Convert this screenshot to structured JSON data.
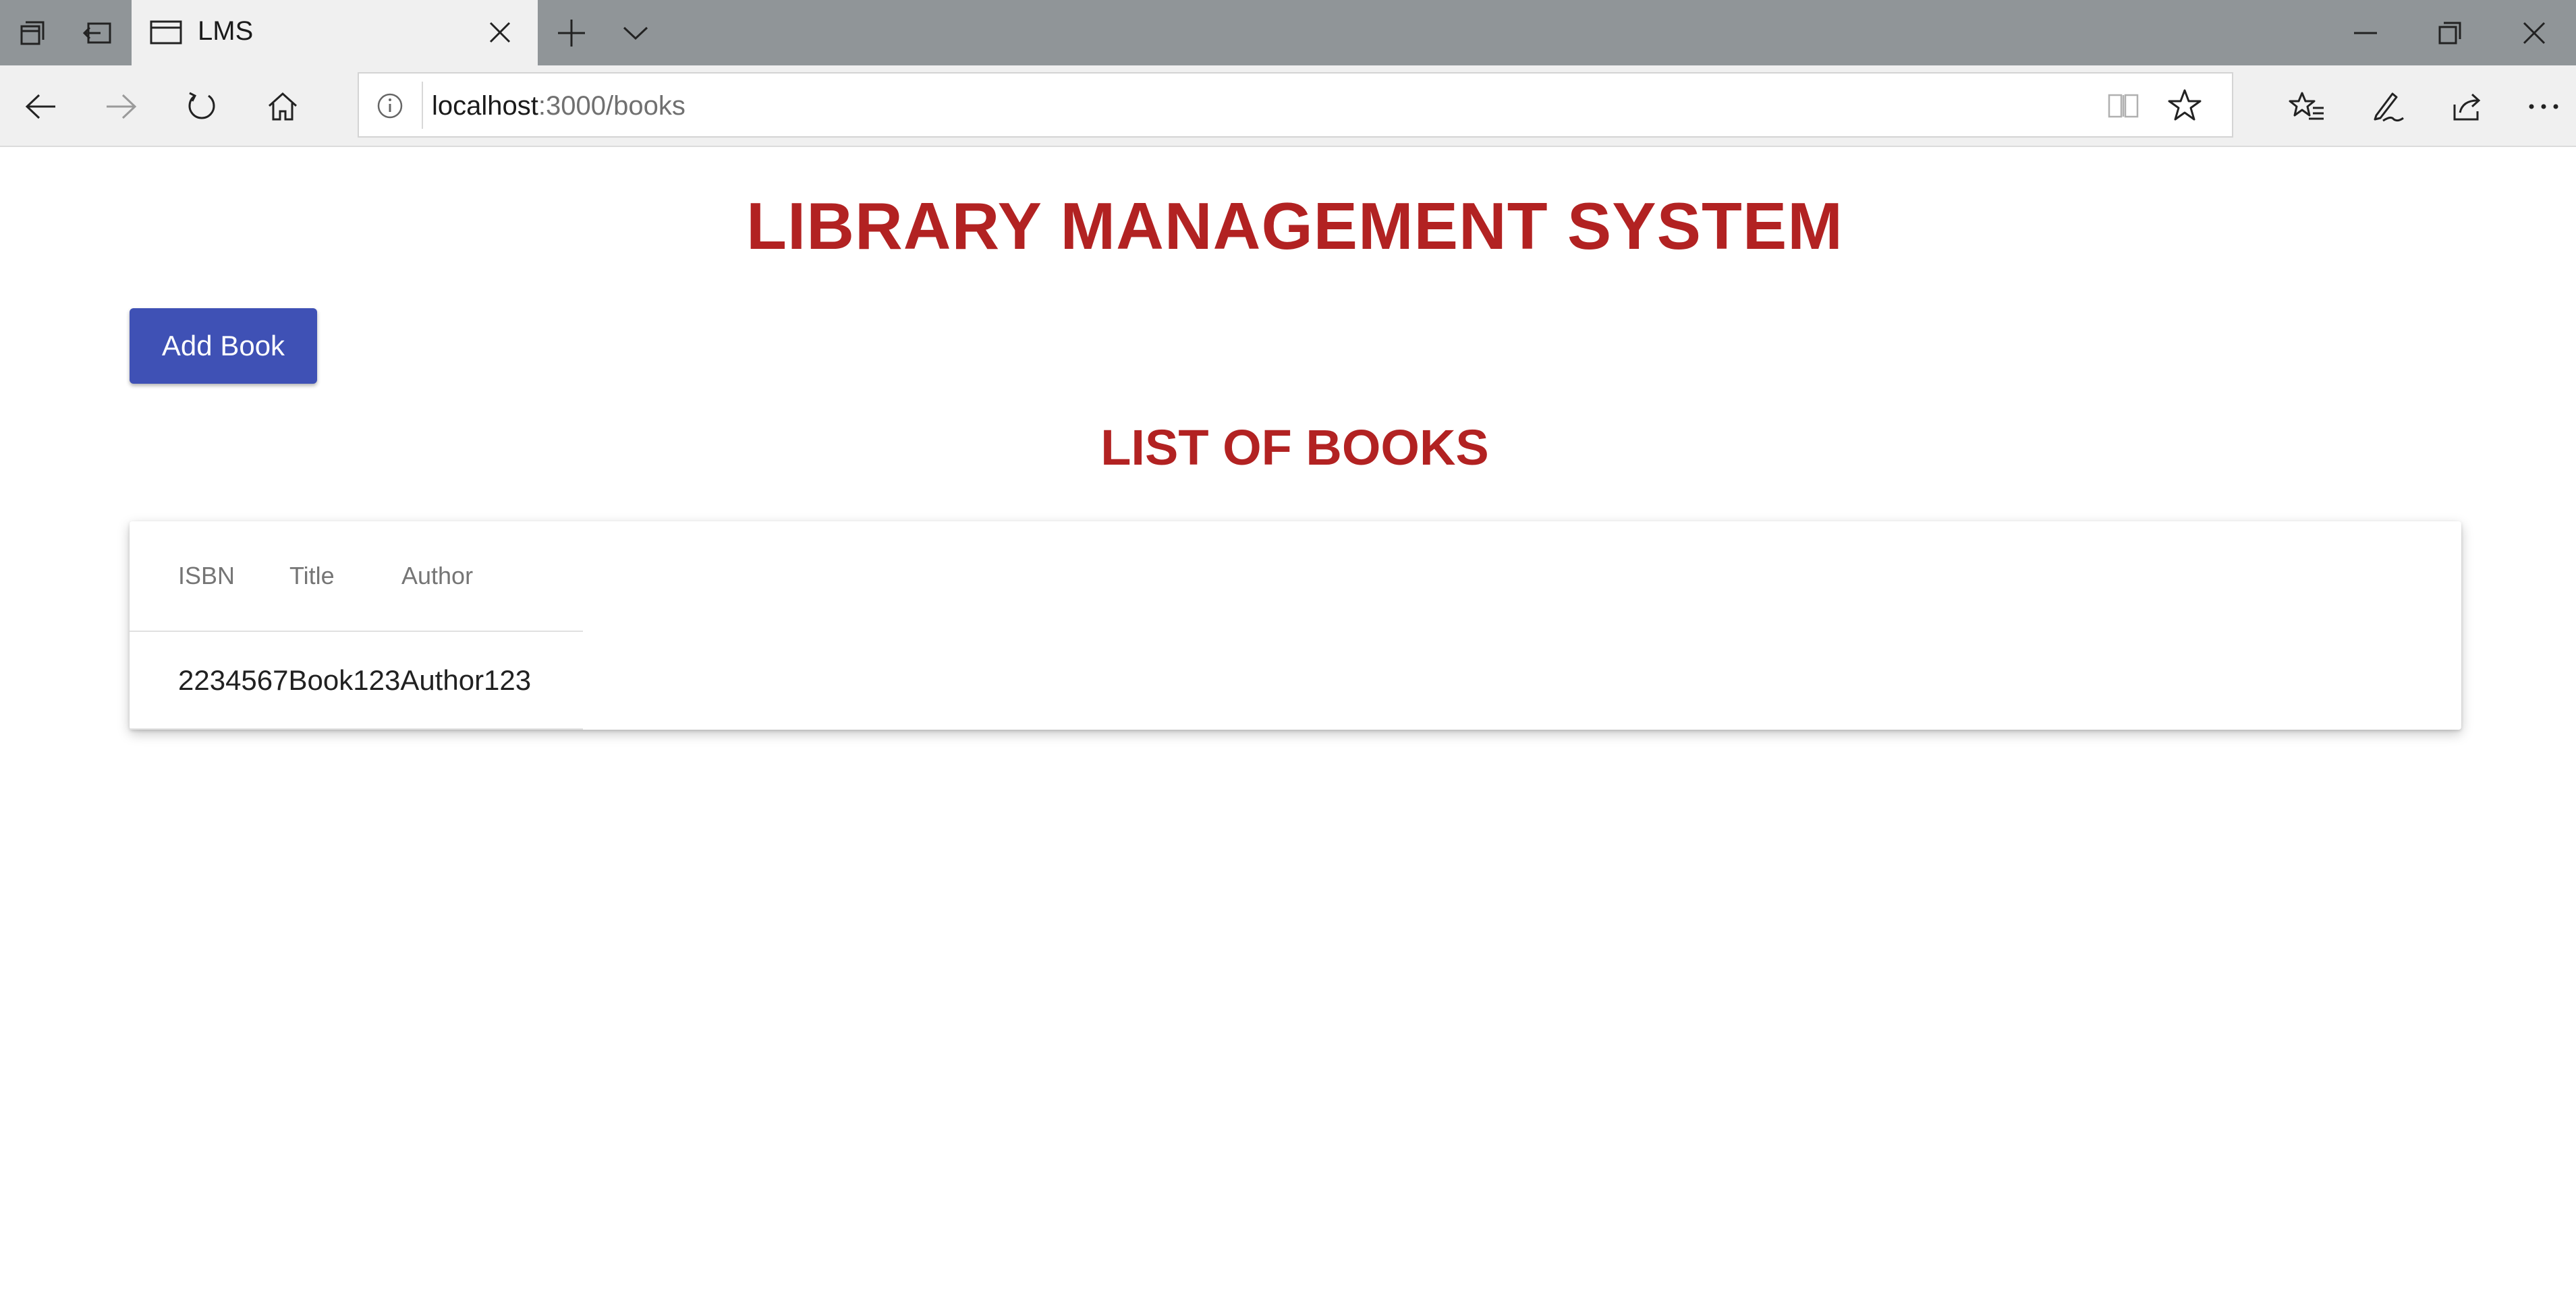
{
  "browser": {
    "tab": {
      "title": "LMS"
    },
    "address": {
      "host": "localhost",
      "path": ":3000/books"
    },
    "icons": [
      "tab-manager-icon",
      "set-aside-tabs-icon",
      "page-icon",
      "close-icon",
      "new-tab-icon",
      "tab-list-icon",
      "minimize-icon",
      "restore-icon",
      "window-close-icon",
      "back-icon",
      "forward-icon",
      "refresh-icon",
      "home-icon",
      "info-icon",
      "reading-view-icon",
      "favorite-star-icon",
      "favorites-list-icon",
      "notes-pen-icon",
      "share-icon",
      "more-icon"
    ]
  },
  "page": {
    "title": "LIBRARY MANAGEMENT SYSTEM",
    "add_button": "Add Book",
    "subtitle": "LIST OF BOOKS",
    "table": {
      "headers": [
        "ISBN",
        "Title",
        "Author"
      ],
      "rows": [
        {
          "text": "2234567Book123Author123"
        }
      ]
    }
  },
  "colors": {
    "heading": "#b22222",
    "button": "#3f51b5",
    "titlebar": "#909598"
  }
}
